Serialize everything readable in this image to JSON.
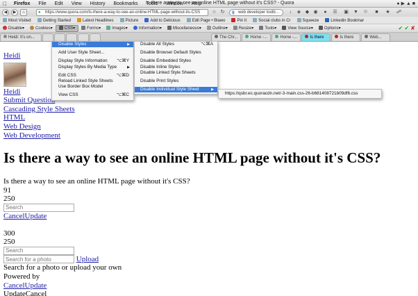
{
  "menubar": {
    "apple": "",
    "items": [
      "Firefox",
      "File",
      "Edit",
      "View",
      "History",
      "Bookmarks",
      "Tools",
      "Window",
      "Help"
    ],
    "window_title": "Is there a way to see an online HTML page without it's CSS? - Quora"
  },
  "navbar": {
    "url": "https://www.quora.com/Is-there-a-way-to-see-an-online-HTML-page-without-its-CSS",
    "search_value": "web developer toolb…"
  },
  "bookmarks": [
    "Most Visited",
    "Getting Started",
    "Latest Headlines",
    "Picture",
    "Add to Delicious",
    "Edit Page • Blawo",
    "Pin It",
    "Social clubs in Cr",
    "Squeeze",
    "Linkedin Bookmar"
  ],
  "webdev_toolbar": {
    "items": [
      "Disable",
      "Cookies",
      "CSS",
      "Forms",
      "Images",
      "Information",
      "Miscellaneous",
      "Outline",
      "Resize",
      "Tools",
      "View Source",
      "Options"
    ],
    "active": "CSS"
  },
  "tabs": [
    "Heidi: It's on...",
    "",
    "",
    "",
    "",
    "",
    "The Chr...",
    "Home -...",
    "Home -...",
    "Is there",
    "Is there",
    "Web..."
  ],
  "css_menu": {
    "items": [
      {
        "label": "Disable Styles",
        "shortcut": "",
        "arrow": "▶",
        "highlighted": true
      },
      {
        "label": "Add User Style Sheet...",
        "shortcut": ""
      },
      {
        "label": "Display Style Information",
        "shortcut": "⌥⌘Y"
      },
      {
        "label": "Display Styles By Media Type",
        "shortcut": "",
        "arrow": "▶"
      },
      {
        "label": "Edit CSS",
        "shortcut": "⌥⌘D"
      },
      {
        "label": "Reload Linked Style Sheets",
        "shortcut": ""
      },
      {
        "label": "Use Border Box Model",
        "shortcut": ""
      },
      {
        "label": "View CSS",
        "shortcut": "⌥⌘C"
      }
    ]
  },
  "disable_styles_menu": {
    "items": [
      {
        "label": "Disable All Styles",
        "shortcut": "⌥⌘A"
      },
      {
        "label": "Disable Browser Default Styles",
        "shortcut": ""
      },
      {
        "label": "Disable Embedded Styles",
        "shortcut": ""
      },
      {
        "label": "Disable Inline Styles",
        "shortcut": ""
      },
      {
        "label": "Disable Linked Style Sheets",
        "shortcut": ""
      },
      {
        "label": "Disable Print Styles",
        "shortcut": ""
      },
      {
        "label": "Disable Individual Style Sheet",
        "shortcut": "",
        "arrow": "▶",
        "highlighted": true
      }
    ]
  },
  "stylesheet_menu": {
    "item": "https://qsbr.ec.quoracdn.net/-3-main.css-26-b681408721b09df6.css"
  },
  "page": {
    "user_link_1": "Heidi",
    "user_link_2": "Heidi",
    "submit_question": "Submit Question",
    "topics": [
      "Cascading Style Sheets",
      "HTML",
      "Web Design",
      "Web Development"
    ],
    "title": "Is there a way to see an online HTML page without it's CSS?",
    "question_text": "Is there a way to see an online HTML page without it's CSS?",
    "num_1": "91",
    "num_2": "250",
    "search_placeholder": "Search",
    "cancel": "Cancel",
    "update": "Update",
    "num_3": "300",
    "num_4": "250",
    "search_placeholder_2": "Search",
    "photo_placeholder": "Search for a photo",
    "upload": "Upload",
    "photo_hint": "Search for a photo or upload your own",
    "powered_by": "Powered by",
    "cancel_2": "Cancel",
    "update_2": "Update",
    "update_cancel_text": "UpdateCancel"
  }
}
